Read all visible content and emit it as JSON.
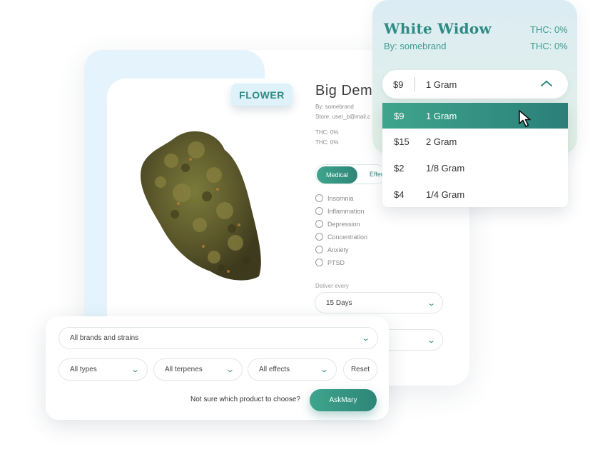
{
  "product": {
    "category_badge": "FLOWER",
    "title": "Big Demo",
    "brand": "By: somebrand",
    "store": "Store: user_b@mail.c",
    "thc_1": "THC: 0%",
    "thc_2": "THC: 0%"
  },
  "segments": {
    "active": "Medical",
    "inactive": "Effects"
  },
  "conditions": [
    "Insomnia",
    "Inflammation",
    "Depression",
    "Concentration",
    "Anxiety",
    "PTSD"
  ],
  "delivery": {
    "label": "Deliver every",
    "value": "15 Days"
  },
  "filters": {
    "brands": "All brands and strains",
    "types": "All types",
    "terpenes": "All terpenes",
    "effects": "All effects",
    "reset": "Reset",
    "prompt": "Not sure which product to choose?",
    "ask_button": "AskMary"
  },
  "strain_popup": {
    "name": "White Widow",
    "brand": "By: somebrand",
    "thc_1": "THC: 0%",
    "thc_2": "THC: 0%",
    "selected_price": "$9",
    "selected_label": "1 Gram",
    "options": [
      {
        "price": "$9",
        "label": "1 Gram"
      },
      {
        "price": "$15",
        "label": "2 Gram"
      },
      {
        "price": "$2",
        "label": "1/8 Gram"
      },
      {
        "price": "$4",
        "label": "1/4 Gram"
      }
    ]
  },
  "colors": {
    "accent": "#2f8a83",
    "accent_gradient_start": "#3ea58d",
    "tab_blue": "#e5f4fc"
  },
  "icons": {
    "select_chevron": "chevron-down-icon",
    "open_chevron": "chevron-up-icon",
    "pointer": "mouse-cursor-icon"
  }
}
